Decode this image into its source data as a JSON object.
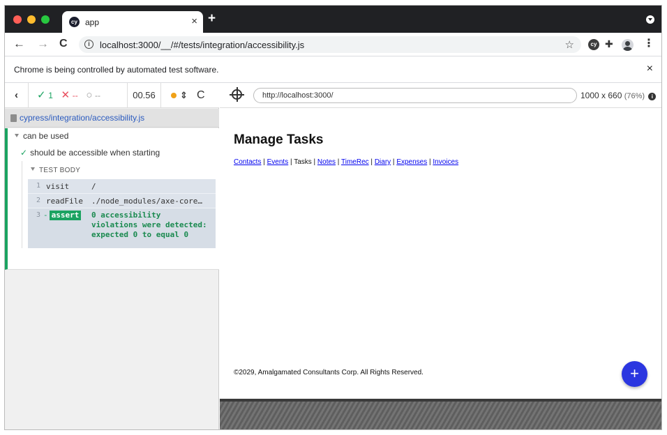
{
  "browser": {
    "tab_title": "app",
    "tab_favicon": "cy",
    "tab_close": "×",
    "new_tab": "+",
    "address_url_host": "localhost",
    "address_url_rest": ":3000/__/#/tests/integration/accessibility.js",
    "infobar_text": "Chrome is being controlled by automated test software.",
    "infobar_close": "×",
    "colors": {
      "titlebar": "#202124",
      "close_dot": "#ff5f57",
      "min_dot": "#febc2e",
      "max_dot": "#28c840"
    }
  },
  "runner": {
    "back": "‹",
    "passed_icon": "✓",
    "passed_count": "1",
    "failed_icon": "✕",
    "failed_count": "--",
    "pending_icon": "○",
    "pending_count": "--",
    "duration": "00.56",
    "reload": "C",
    "spec_path": "cypress/integration/accessibility.js",
    "suite_title": "can be used",
    "test_title": "should be accessible when starting",
    "test_body_label": "TEST BODY",
    "commands": [
      {
        "num": "1",
        "name": "visit",
        "message": "/"
      },
      {
        "num": "2",
        "name": "readFile",
        "message": "./node_modules/axe-core…"
      },
      {
        "num": "3",
        "name": "assert",
        "prefix": "-",
        "message": "0 accessibility violations were detected: expected 0 to equal 0"
      }
    ],
    "colors": {
      "pass": "#1ba361",
      "fail": "#e94f5f",
      "running_dot": "#f0a117",
      "link": "#2b5bbf"
    }
  },
  "aut": {
    "url": "http://localhost:3000/",
    "viewport": "1000 x 660",
    "scale": "(76%)",
    "page_title": "Manage Tasks",
    "nav": [
      {
        "label": "Contacts",
        "link": true
      },
      {
        "label": "Events",
        "link": true
      },
      {
        "label": "Tasks",
        "link": false
      },
      {
        "label": "Notes",
        "link": true
      },
      {
        "label": "TimeRec",
        "link": true
      },
      {
        "label": "Diary",
        "link": true
      },
      {
        "label": "Expenses",
        "link": true
      },
      {
        "label": "Invoices",
        "link": true
      }
    ],
    "footer": "©2029, Amalgamated Consultants Corp. All Rights Reserved.",
    "fab_label": "+",
    "colors": {
      "fab": "#2b36e0"
    }
  }
}
